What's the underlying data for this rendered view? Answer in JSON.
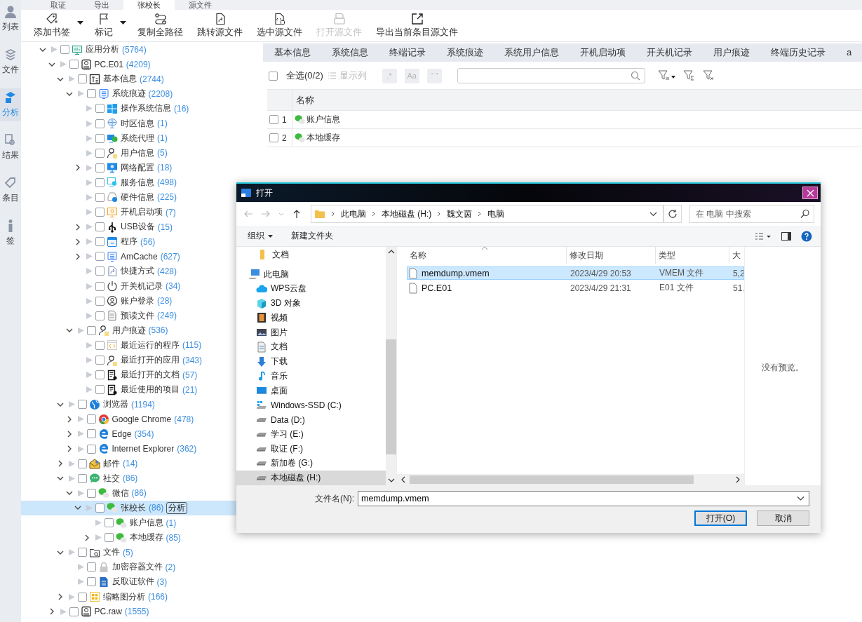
{
  "side_nav": [
    {
      "label": "列表",
      "kind": "list",
      "selected": false
    },
    {
      "label": "文件",
      "kind": "layers",
      "selected": false
    },
    {
      "label": "分析",
      "kind": "analysis",
      "selected": true
    },
    {
      "label": "结果",
      "kind": "search",
      "selected": false
    },
    {
      "label": "条目",
      "kind": "tag",
      "selected": false
    },
    {
      "label": "签",
      "kind": "info",
      "selected": false
    }
  ],
  "doc_tabs": [
    {
      "label": "取证",
      "selected": false
    },
    {
      "label": "导出",
      "selected": false
    },
    {
      "label": "张校长",
      "selected": true
    },
    {
      "label": "源文件",
      "selected": false
    }
  ],
  "toolbar": [
    {
      "label": "添加书签",
      "kind": "tag",
      "dropdown": true,
      "disabled": false
    },
    {
      "label": "标记",
      "kind": "flag",
      "dropdown": true,
      "disabled": false
    },
    {
      "label": "复制全路径",
      "kind": "path",
      "dropdown": false,
      "disabled": false
    },
    {
      "label": "跳转源文件",
      "kind": "jump",
      "dropdown": false,
      "disabled": false
    },
    {
      "label": "选中源文件",
      "kind": "select",
      "dropdown": false,
      "disabled": false
    },
    {
      "label": "打开源文件",
      "kind": "open",
      "dropdown": false,
      "disabled": true
    },
    {
      "label": "导出当前条目源文件",
      "kind": "export",
      "dropdown": false,
      "disabled": false
    }
  ],
  "tree": [
    {
      "label": "应用分析",
      "count": "(5764)",
      "kind": "monitor",
      "checked": false,
      "selected": false,
      "expanded": true,
      "children": [
        {
          "label": "PC.E01",
          "count": "(4209)",
          "kind": "disk",
          "checked": false,
          "selected": false,
          "expanded": true,
          "children": [
            {
              "label": "基本信息",
              "count": "(2744)",
              "kind": "text",
              "checked": false,
              "selected": false,
              "expanded": true,
              "children": [
                {
                  "label": "系统痕迹",
                  "count": "(2208)",
                  "kind": "list",
                  "checked": false,
                  "selected": false,
                  "expanded": true,
                  "children": [
                    {
                      "label": "操作系统信息",
                      "count": "(16)",
                      "kind": "tiles",
                      "checked": false,
                      "selected": false
                    },
                    {
                      "label": "时区信息",
                      "count": "(1)",
                      "kind": "globe",
                      "checked": false,
                      "selected": false
                    },
                    {
                      "label": "系统代理",
                      "count": "(1)",
                      "kind": "proxy",
                      "checked": false,
                      "selected": false
                    },
                    {
                      "label": "用户信息",
                      "count": "(5)",
                      "kind": "user",
                      "checked": false,
                      "selected": false
                    },
                    {
                      "label": "网络配置",
                      "count": "(18)",
                      "kind": "screen",
                      "checked": false,
                      "selected": false,
                      "expanded": false
                    },
                    {
                      "label": "服务信息",
                      "count": "(498)",
                      "kind": "service",
                      "checked": false,
                      "selected": false
                    },
                    {
                      "label": "硬件信息",
                      "count": "(225)",
                      "kind": "hardware",
                      "checked": false,
                      "selected": false
                    },
                    {
                      "label": "开机启动项",
                      "count": "(7)",
                      "kind": "startup",
                      "checked": false,
                      "selected": false
                    },
                    {
                      "label": "USB设备",
                      "count": "(15)",
                      "kind": "usb",
                      "checked": false,
                      "selected": false,
                      "expanded": false
                    },
                    {
                      "label": "程序",
                      "count": "(56)",
                      "kind": "app",
                      "checked": false,
                      "selected": false,
                      "expanded": false
                    },
                    {
                      "label": "AmCache",
                      "count": "(627)",
                      "kind": "list",
                      "checked": false,
                      "selected": false,
                      "expanded": false
                    },
                    {
                      "label": "快捷方式",
                      "count": "(428)",
                      "kind": "shortcut",
                      "checked": false,
                      "selected": false
                    },
                    {
                      "label": "开关机记录",
                      "count": "(34)",
                      "kind": "power",
                      "checked": false,
                      "selected": false
                    },
                    {
                      "label": "账户登录",
                      "count": "(28)",
                      "kind": "account",
                      "checked": false,
                      "selected": false
                    },
                    {
                      "label": "预读文件",
                      "count": "(249)",
                      "kind": "doc",
                      "checked": false,
                      "selected": false
                    }
                  ]
                },
                {
                  "label": "用户痕迹",
                  "count": "(536)",
                  "kind": "user",
                  "checked": false,
                  "selected": false,
                  "expanded": true,
                  "children": [
                    {
                      "label": "最近运行的程序",
                      "count": "(115)",
                      "kind": "code",
                      "checked": false,
                      "selected": false
                    },
                    {
                      "label": "最近打开的应用",
                      "count": "(343)",
                      "kind": "user",
                      "checked": false,
                      "selected": false
                    },
                    {
                      "label": "最近打开的文档",
                      "count": "(57)",
                      "kind": "docview",
                      "checked": false,
                      "selected": false
                    },
                    {
                      "label": "最近使用的项目",
                      "count": "(21)",
                      "kind": "docview",
                      "checked": false,
                      "selected": false
                    }
                  ]
                }
              ]
            },
            {
              "label": "浏览器",
              "count": "(1194)",
              "kind": "earth",
              "checked": false,
              "selected": false,
              "expanded": true,
              "children": [
                {
                  "label": "Google Chrome",
                  "count": "(478)",
                  "kind": "wheel",
                  "checked": false,
                  "selected": false,
                  "expanded": false
                },
                {
                  "label": "Edge",
                  "count": "(354)",
                  "kind": "edge",
                  "checked": false,
                  "selected": false,
                  "expanded": false
                },
                {
                  "label": "Internet Explorer",
                  "count": "(362)",
                  "kind": "edge",
                  "checked": false,
                  "selected": false,
                  "expanded": false
                }
              ]
            },
            {
              "label": "邮件",
              "count": "(14)",
              "kind": "mail",
              "checked": false,
              "selected": false,
              "expanded": false
            },
            {
              "label": "社交",
              "count": "(86)",
              "kind": "chat",
              "checked": false,
              "selected": false,
              "expanded": true,
              "children": [
                {
                  "label": "微信",
                  "count": "(86)",
                  "kind": "bubbles",
                  "checked": false,
                  "selected": false,
                  "expanded": true,
                  "children": [
                    {
                      "label": "张校长",
                      "count": "(86)",
                      "kind": "bubbles",
                      "checked": false,
                      "selected": true,
                      "expanded": true,
                      "badge": "分析",
                      "children": [
                        {
                          "label": "账户信息",
                          "count": "(1)",
                          "kind": "bubbles",
                          "checked": false,
                          "selected": false
                        },
                        {
                          "label": "本地缓存",
                          "count": "(85)",
                          "kind": "bubbles",
                          "checked": false,
                          "selected": false,
                          "expanded": false
                        }
                      ]
                    }
                  ]
                }
              ]
            },
            {
              "label": "文件",
              "count": "(5)",
              "kind": "folder",
              "checked": false,
              "selected": false,
              "expanded": true,
              "children": [
                {
                  "label": "加密容器文件",
                  "count": "(2)",
                  "kind": "lock",
                  "checked": false,
                  "selected": false
                },
                {
                  "label": "反取证软件",
                  "count": "(3)",
                  "kind": "filedoc",
                  "checked": false,
                  "selected": false
                }
              ]
            },
            {
              "label": "缩略图分析",
              "count": "(166)",
              "kind": "grid",
              "checked": false,
              "selected": false,
              "expanded": false
            }
          ]
        },
        {
          "label": "PC.raw",
          "count": "(1555)",
          "kind": "disk",
          "checked": false,
          "selected": false,
          "expanded": false
        }
      ]
    }
  ],
  "category_tabs": [
    {
      "label": "基本信息",
      "selected": false
    },
    {
      "label": "系统信息",
      "selected": false
    },
    {
      "label": "终端记录",
      "selected": false
    },
    {
      "label": "系统痕迹",
      "selected": false
    },
    {
      "label": "系统用户信息",
      "selected": false
    },
    {
      "label": "开机启动项",
      "selected": false
    },
    {
      "label": "开关机记录",
      "selected": false
    },
    {
      "label": "用户痕迹",
      "selected": false
    },
    {
      "label": "终端历史记录",
      "selected": false
    },
    {
      "label": "a",
      "selected": false
    }
  ],
  "filter_bar": {
    "select_all": {
      "label": "全选(0/2)",
      "checked": false
    },
    "show_columns": {
      "label": "显示列",
      "disabled": true
    },
    "toggles": [
      {
        "label": ".*",
        "on": false
      },
      {
        "label": "Aa",
        "on": false
      },
      {
        "label": "“ ”",
        "on": false
      }
    ]
  },
  "table": {
    "columns": [
      "名称"
    ],
    "rows": [
      {
        "index": "1",
        "name": "账户信息",
        "checked": false
      },
      {
        "index": "2",
        "name": "本地缓存",
        "checked": false
      }
    ]
  },
  "dialog": {
    "title": "打开",
    "breadcrumb": [
      "此电脑",
      "本地磁盘 (H:)",
      "魏文茵",
      "电脑"
    ],
    "search": {
      "placeholder": "在 电脑 中搜索"
    },
    "commands": [
      {
        "label": "组织",
        "dropdown": true
      },
      {
        "label": "新建文件夹",
        "dropdown": false
      }
    ],
    "nav": [
      {
        "label": "文档",
        "kind": "folder",
        "selected": false
      },
      {
        "label": "此电脑",
        "kind": "pc",
        "selected": false,
        "children": [
          {
            "label": "WPS云盘",
            "kind": "cloud",
            "selected": false
          },
          {
            "label": "3D 对象",
            "kind": "cube",
            "selected": false
          },
          {
            "label": "视频",
            "kind": "video",
            "selected": false
          },
          {
            "label": "图片",
            "kind": "picture",
            "selected": false
          },
          {
            "label": "文档",
            "kind": "doc",
            "selected": false
          },
          {
            "label": "下载",
            "kind": "download",
            "selected": false
          },
          {
            "label": "音乐",
            "kind": "music",
            "selected": false
          },
          {
            "label": "桌面",
            "kind": "desktop",
            "selected": false
          },
          {
            "label": "Windows-SSD (C:)",
            "kind": "system-drive",
            "selected": false
          },
          {
            "label": "Data (D:)",
            "kind": "drive",
            "selected": false
          },
          {
            "label": "学习 (E:)",
            "kind": "drive",
            "selected": false
          },
          {
            "label": "取证 (F:)",
            "kind": "drive",
            "selected": false
          },
          {
            "label": "新加卷 (G:)",
            "kind": "drive",
            "selected": false
          },
          {
            "label": "本地磁盘 (H:)",
            "kind": "drive",
            "selected": true
          }
        ]
      }
    ],
    "columns": [
      "名称",
      "修改日期",
      "类型",
      "大"
    ],
    "files": [
      {
        "name": "memdump.vmem",
        "modified": "2023/4/29 20:53",
        "type": "VMEM 文件",
        "size": "5,2",
        "selected": true
      },
      {
        "name": "PC.E01",
        "modified": "2023/4/29 21:31",
        "type": "E01 文件",
        "size": "51,",
        "selected": false
      }
    ],
    "preview": "没有预览。",
    "filename_label": "文件名(N):",
    "filename": "memdump.vmem",
    "buttons": [
      {
        "label": "打开(O)",
        "kind": "primary"
      },
      {
        "label": "取消",
        "kind": "secondary"
      }
    ]
  }
}
